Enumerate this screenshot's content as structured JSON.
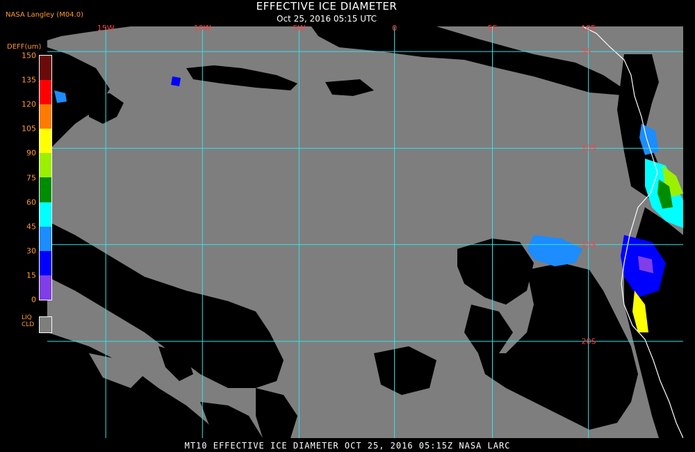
{
  "header": {
    "credit": "NASA Langley (M04.0)",
    "title": "EFFECTIVE ICE DIAMETER",
    "subtitle": "Oct 25, 2016 05:15 UTC"
  },
  "colors": {
    "liquid_cloud": "#7e7e7e",
    "clear": "#000000",
    "grid": "#2ee6ee",
    "coastline": "#ffffff",
    "label": "#ff4040",
    "legend_text": "#ff9a2e"
  },
  "grid": {
    "longitudes": [
      {
        "label": "15W",
        "x": 0.092
      },
      {
        "label": "10W",
        "x": 0.244
      },
      {
        "label": "5W",
        "x": 0.396
      },
      {
        "label": "0",
        "x": 0.546
      },
      {
        "label": "5E",
        "x": 0.7
      },
      {
        "label": "10E",
        "x": 0.851
      }
    ],
    "latitudes": [
      {
        "label": "5S",
        "y": 0.061
      },
      {
        "label": "10S",
        "y": 0.296
      },
      {
        "label": "15S",
        "y": 0.53
      },
      {
        "label": "20S",
        "y": 0.765
      }
    ]
  },
  "legend": {
    "title": "DEFF(um)",
    "ticks": [
      "150",
      "135",
      "120",
      "105",
      "90",
      "75",
      "60",
      "45",
      "30",
      "15",
      "0"
    ],
    "colors": [
      "#6b0a0a",
      "#ff0000",
      "#ff7b00",
      "#ffff00",
      "#9bf000",
      "#008c00",
      "#00ffff",
      "#1c8cff",
      "#0000ff",
      "#7f3ee8"
    ],
    "liquid_cloud_label": [
      "LIQ",
      "CLD"
    ]
  },
  "footer": {
    "text": "MT10  EFFECTIVE ICE DIAMETER   OCT 25, 2016 05:15Z   NASA LARC"
  }
}
